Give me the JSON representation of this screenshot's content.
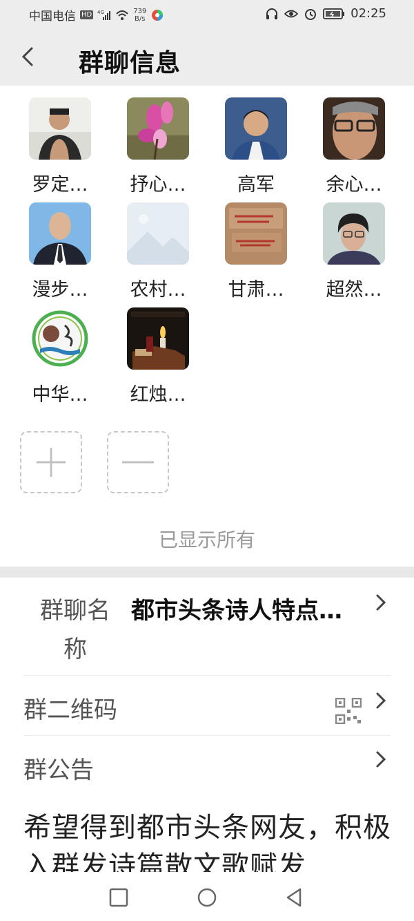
{
  "status_bar": {
    "carrier": "中国电信",
    "hd": "HD",
    "net_speed_value": "739",
    "net_speed_unit": "B/s",
    "time": "02:25"
  },
  "header": {
    "title": "群聊信息",
    "back_icon": "chevron-left-icon"
  },
  "members": [
    {
      "name": "罗定…",
      "avatar": "photo-man-tank-top"
    },
    {
      "name": "抒心…",
      "avatar": "photo-magnolia"
    },
    {
      "name": "高军",
      "avatar": "photo-young-man"
    },
    {
      "name": "余心…",
      "avatar": "photo-man-glasses"
    },
    {
      "name": "漫步…",
      "avatar": "photo-man-suit"
    },
    {
      "name": "农村…",
      "avatar": "placeholder-image"
    },
    {
      "name": "甘肃…",
      "avatar": "photo-calligraphy"
    },
    {
      "name": "超然…",
      "avatar": "photo-woman-glasses"
    },
    {
      "name": "中华…",
      "avatar": "logo-round-emblem"
    },
    {
      "name": "红烛…",
      "avatar": "photo-candle"
    }
  ],
  "member_actions": {
    "add_icon": "plus-icon",
    "remove_icon": "minus-icon"
  },
  "show_all_text": "已显示所有",
  "settings": {
    "group_name_label": "群聊名称",
    "group_name_value": "都市头条诗人特点…",
    "qr_label": "群二维码",
    "qr_icon": "qr-code-icon",
    "notice_label": "群公告",
    "notice_text": "希望得到都市头条网友，积极入群发诗篇散文歌赋发"
  },
  "nav": {
    "recent_icon": "square-icon",
    "home_icon": "circle-icon",
    "back_icon": "triangle-back-icon"
  },
  "colors": {
    "header_bg": "#ededed",
    "divider": "#e8e8e8",
    "muted_text": "#9a9a9a"
  }
}
